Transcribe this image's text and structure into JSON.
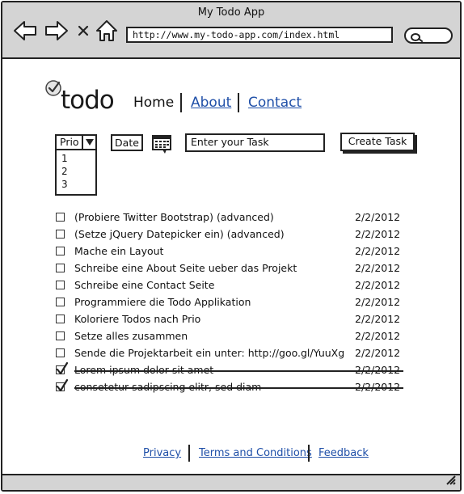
{
  "window": {
    "title": "My Todo App"
  },
  "browser": {
    "url": "http://www.my-todo-app.com/index.html",
    "icons": [
      "back-arrow-icon",
      "forward-arrow-icon",
      "close-x-icon",
      "home-icon",
      "search-icon"
    ]
  },
  "header": {
    "logo_text": "todo",
    "nav": [
      {
        "label": "Home"
      },
      {
        "label": "About"
      },
      {
        "label": "Contact"
      }
    ]
  },
  "form": {
    "prio_label": "Prio",
    "prio_options": [
      "1",
      "2",
      "3"
    ],
    "date_label": "Date",
    "task_input_value": "Enter your Task",
    "create_button": "Create Task"
  },
  "todos": [
    {
      "title": "(Probiere Twitter Bootstrap) (advanced)",
      "date": "2/2/2012",
      "done": false
    },
    {
      "title": "(Setze jQuery Datepicker ein) (advanced)",
      "date": "2/2/2012",
      "done": false
    },
    {
      "title": "Mache ein Layout",
      "date": "2/2/2012",
      "done": false
    },
    {
      "title": "Schreibe eine About Seite ueber das Projekt",
      "date": "2/2/2012",
      "done": false
    },
    {
      "title": "Schreibe eine Contact Seite",
      "date": "2/2/2012",
      "done": false
    },
    {
      "title": "Programmiere die Todo Applikation",
      "date": "2/2/2012",
      "done": false
    },
    {
      "title": "Koloriere Todos nach Prio",
      "date": "2/2/2012",
      "done": false
    },
    {
      "title": "Setze alles zusammen",
      "date": "2/2/2012",
      "done": false
    },
    {
      "title": "Sende die Projektarbeit ein unter: http://goo.gl/YuuXg",
      "date": "2/2/2012",
      "done": false
    },
    {
      "title": "Lorem ipsum dolor sit amet",
      "date": "2/2/2012",
      "done": true
    },
    {
      "title": "consetetur sadipscing elitr, sed diam",
      "date": "2/2/2012",
      "done": true
    }
  ],
  "footer": {
    "links": [
      {
        "label": "Privacy"
      },
      {
        "label": "Terms and Conditions"
      },
      {
        "label": "Feedback"
      }
    ]
  },
  "colors": {
    "chrome": "#d4d4d4",
    "link": "#1f4fa8",
    "ink": "#222222"
  }
}
